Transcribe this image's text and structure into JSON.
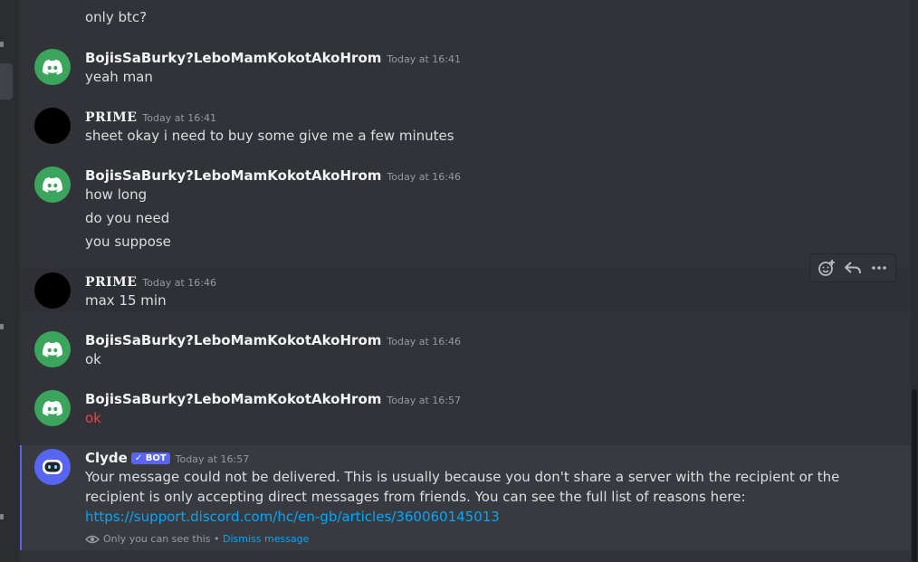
{
  "truncated_top": "only btc?",
  "messages": [
    {
      "author": "BojisSaBurky?LeboMamKokotAkoHrom",
      "time": "Today at 16:41",
      "lines": [
        "yeah man"
      ]
    },
    {
      "author": "PRIME",
      "time": "Today at 16:41",
      "lines": [
        "sheet okay i need to buy some give me a few minutes"
      ]
    },
    {
      "author": "BojisSaBurky?LeboMamKokotAkoHrom",
      "time": "Today at 16:46",
      "lines": [
        "how long",
        "do you need",
        "you suppose"
      ]
    },
    {
      "author": "PRIME",
      "time": "Today at 16:46",
      "lines": [
        "max 15 min"
      ]
    },
    {
      "author": "BojisSaBurky?LeboMamKokotAkoHrom",
      "time": "Today at 16:46",
      "lines": [
        "ok"
      ]
    },
    {
      "author": "BojisSaBurky?LeboMamKokotAkoHrom",
      "time": "Today at 16:57",
      "lines": [
        "ok"
      ],
      "failed": true
    }
  ],
  "clyde": {
    "author": "Clyde",
    "bot_tag": "BOT",
    "time": "Today at 16:57",
    "text": "Your message could not be delivered. This is usually because you don't share a server with the recipient or the recipient is only accepting direct messages from friends. You can see the full list of reasons here: ",
    "link": "https://support.discord.com/hc/en-gb/articles/360060145013",
    "only_you": "Only you can see this",
    "separator": "•",
    "dismiss": "Dismiss message"
  },
  "toolbar": {
    "icons": [
      "add-reaction-icon",
      "reply-icon",
      "more-icon"
    ]
  },
  "colors": {
    "background": "#313338",
    "blurple": "#5865f2",
    "green_avatar": "#3ba55d",
    "link": "#00a8fc",
    "error": "#f23f42"
  }
}
